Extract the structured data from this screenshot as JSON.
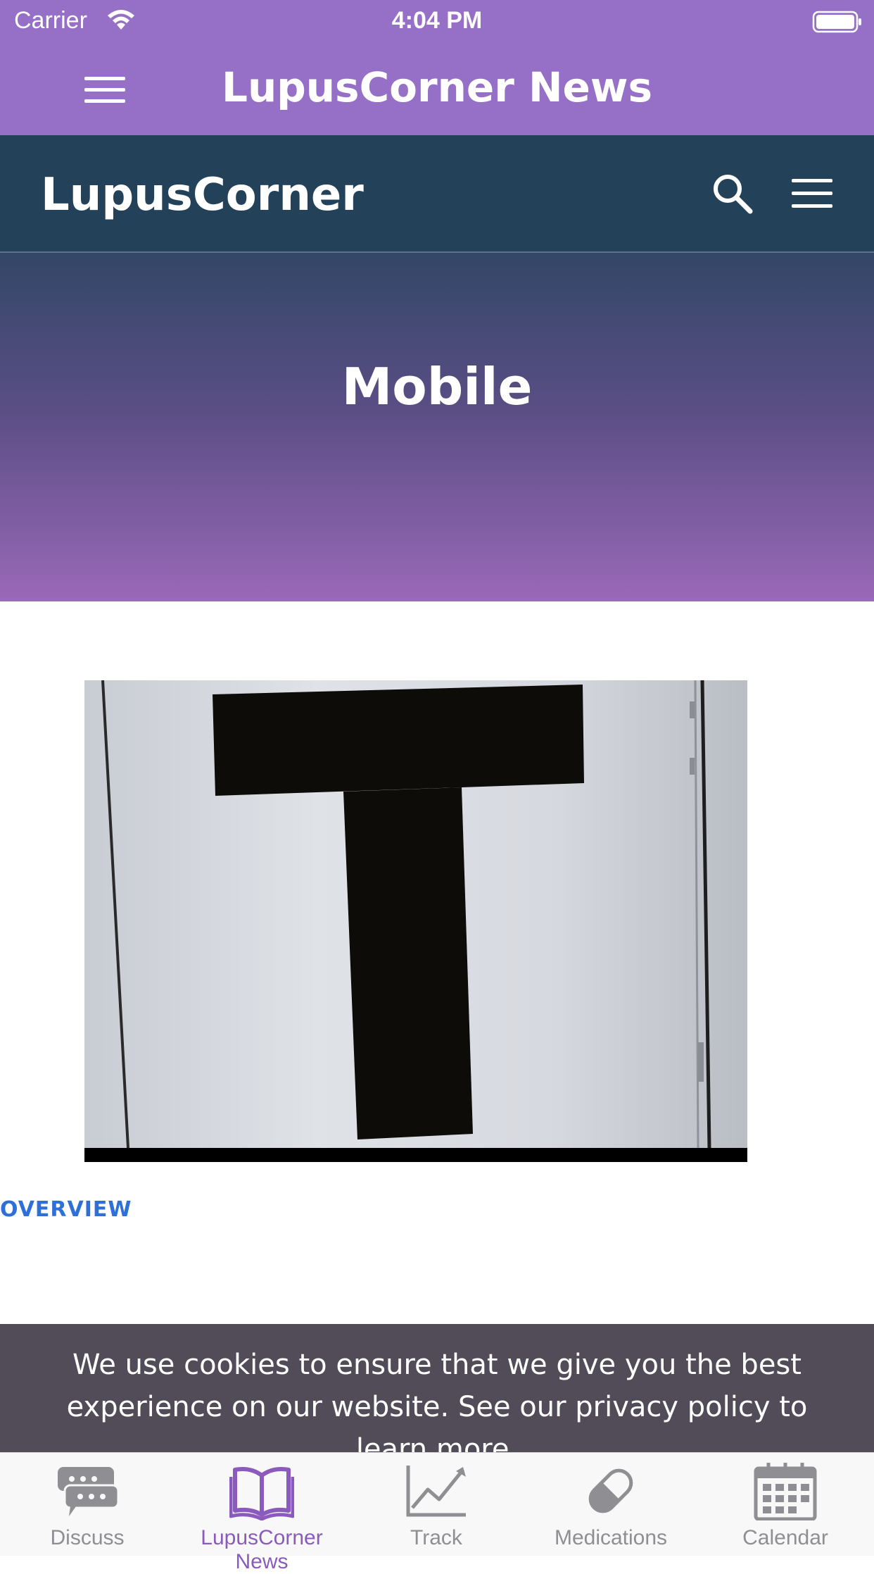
{
  "status_bar": {
    "carrier": "Carrier",
    "time": "4:04 PM"
  },
  "app_nav": {
    "title": "LupusCorner News"
  },
  "site_header": {
    "logo": "LupusCorner"
  },
  "hero": {
    "title": "Mobile"
  },
  "article": {
    "section_link": "OVERVIEW"
  },
  "cookie_banner": {
    "text": "We use cookies to ensure that we give you the best experience on our website. See our privacy policy to learn more."
  },
  "tab_bar": {
    "tabs": [
      {
        "label": "Discuss",
        "icon": "chat-bubbles-icon"
      },
      {
        "label": "LupusCorner News",
        "icon": "open-book-icon"
      },
      {
        "label": "Track",
        "icon": "line-chart-icon"
      },
      {
        "label": "Medications",
        "icon": "pill-icon"
      },
      {
        "label": "Calendar",
        "icon": "calendar-icon"
      }
    ],
    "active_index": 1
  },
  "colors": {
    "app_purple": "#9670c6",
    "site_header": "#23425a",
    "link_blue": "#2e6fd8",
    "tab_active": "#8a5bbd",
    "tab_inactive": "#8e8e93",
    "cookie_bg": "#524b58"
  }
}
